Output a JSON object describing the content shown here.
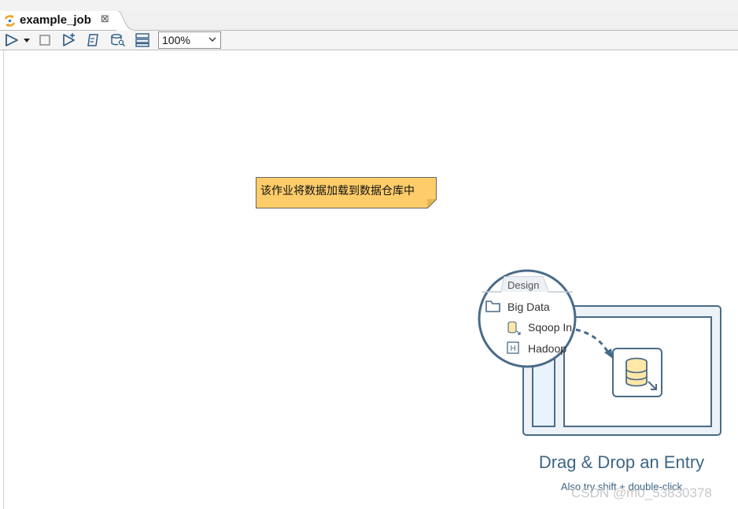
{
  "tab": {
    "title": "example_job",
    "close_glyph": "⊠"
  },
  "toolbar": {
    "run_icon": "play-icon",
    "run_dropdown_icon": "chevron-down-icon",
    "stop_icon": "stop-icon",
    "zoom_value": "100%"
  },
  "canvas": {
    "note_text": "该作业将数据加载到数据仓库中",
    "note_color": "#fecd6a"
  },
  "illustration": {
    "design_tab": "Design",
    "tree_folder": "Big Data",
    "tree_item_1": "Sqoop In",
    "tree_item_2": "Hadoop",
    "tree_item_2_badge": "H",
    "title": "Drag & Drop an Entry",
    "subtitle": "Also try shift + double-click",
    "accent": "#3d6684"
  },
  "watermark": "CSDN @m0_53830378"
}
